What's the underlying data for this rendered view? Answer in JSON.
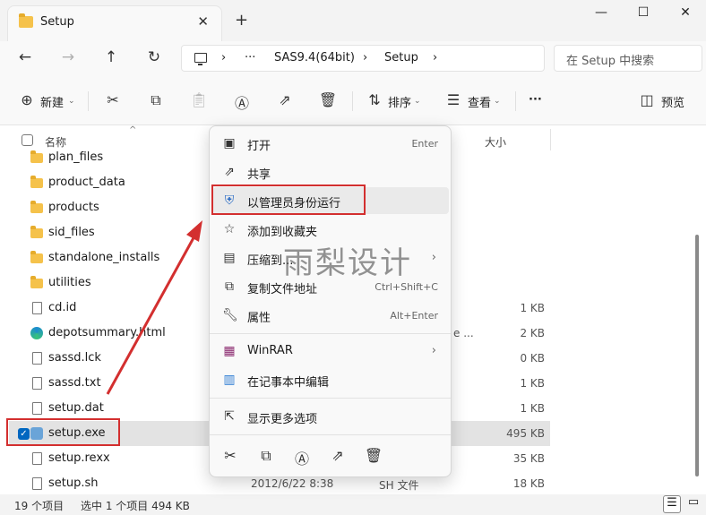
{
  "window": {
    "tab_title": "Setup",
    "tab_close": "✕",
    "new_tab": "+",
    "minimize": "—",
    "maximize": "☐",
    "close": "✕"
  },
  "nav": {
    "breadcrumb_more": "···",
    "breadcrumb": [
      "SAS9.4(64bit)",
      "Setup"
    ],
    "search_placeholder": "在 Setup 中搜索"
  },
  "toolbar": {
    "new_label": "新建",
    "sort_label": "排序",
    "view_label": "查看",
    "more_label": "···",
    "preview_label": "预览"
  },
  "columns": {
    "name": "名称",
    "size": "大小"
  },
  "files": [
    {
      "name": "plan_files",
      "type": "folder",
      "size": ""
    },
    {
      "name": "product_data",
      "type": "folder",
      "size": ""
    },
    {
      "name": "products",
      "type": "folder",
      "size": ""
    },
    {
      "name": "sid_files",
      "type": "folder",
      "size": ""
    },
    {
      "name": "standalone_installs",
      "type": "folder",
      "size": ""
    },
    {
      "name": "utilities",
      "type": "folder",
      "size": ""
    },
    {
      "name": "cd.id",
      "type": "file",
      "size": "1 KB"
    },
    {
      "name": "depotsummary.html",
      "type": "html",
      "size": "2 KB",
      "extra": "e ..."
    },
    {
      "name": "sassd.lck",
      "type": "file",
      "size": "0 KB"
    },
    {
      "name": "sassd.txt",
      "type": "file",
      "size": "1 KB"
    },
    {
      "name": "setup.dat",
      "type": "file",
      "size": "1 KB"
    },
    {
      "name": "setup.exe",
      "type": "exe",
      "size": "495 KB",
      "selected": true
    },
    {
      "name": "setup.rexx",
      "type": "file",
      "size": "35 KB"
    },
    {
      "name": "setup.sh",
      "type": "file",
      "size": "18 KB",
      "date": "2012/6/22 8:38",
      "kind": "SH 文件"
    }
  ],
  "context_menu": {
    "items": [
      {
        "label": "打开",
        "shortcut": "Enter",
        "icon": "open-icon"
      },
      {
        "label": "共享",
        "shortcut": "",
        "icon": "share-icon"
      },
      {
        "label": "以管理员身份运行",
        "shortcut": "",
        "icon": "shield-icon"
      },
      {
        "label": "添加到收藏夹",
        "shortcut": "",
        "icon": "star-icon"
      },
      {
        "label": "压缩到...",
        "shortcut": "",
        "icon": "zip-icon",
        "submenu": true
      },
      {
        "label": "复制文件地址",
        "shortcut": "Ctrl+Shift+C",
        "icon": "copy-path-icon"
      },
      {
        "label": "属性",
        "shortcut": "Alt+Enter",
        "icon": "wrench-icon"
      },
      {
        "label": "WinRAR",
        "shortcut": "",
        "icon": "winrar-icon",
        "submenu": true
      },
      {
        "label": "在记事本中编辑",
        "shortcut": "",
        "icon": "notepad-icon"
      },
      {
        "label": "显示更多选项",
        "shortcut": "",
        "icon": "more-options-icon"
      }
    ]
  },
  "status": {
    "item_count": "19 个项目",
    "selection": "选中 1 个项目  494 KB"
  },
  "watermark": "雨梨设计"
}
